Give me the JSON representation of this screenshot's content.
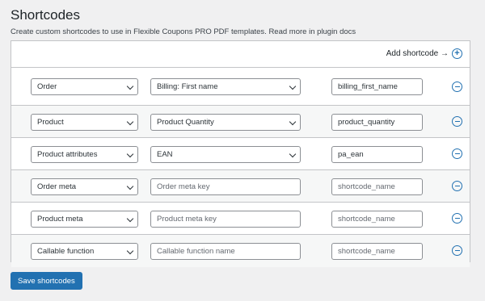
{
  "page": {
    "title": "Shortcodes",
    "description": "Create custom shortcodes to use in Flexible Coupons PRO PDF templates. Read more in plugin docs"
  },
  "panel": {
    "add_label": "Add shortcode →",
    "add_icon": "plus-circle-icon"
  },
  "rows": [
    {
      "type": "Order",
      "field": "Billing: First name",
      "field_kind": "select",
      "shortcode": "billing_first_name",
      "shortcode_is_placeholder": false
    },
    {
      "type": "Product",
      "field": "Product Quantity",
      "field_kind": "select",
      "shortcode": "product_quantity",
      "shortcode_is_placeholder": false
    },
    {
      "type": "Product attributes",
      "field": "EAN",
      "field_kind": "select",
      "shortcode": "pa_ean",
      "shortcode_is_placeholder": false
    },
    {
      "type": "Order meta",
      "field": "Order meta key",
      "field_kind": "input-placeholder",
      "shortcode": "shortcode_name",
      "shortcode_is_placeholder": true
    },
    {
      "type": "Product meta",
      "field": "Product meta key",
      "field_kind": "input-placeholder",
      "shortcode": "shortcode_name",
      "shortcode_is_placeholder": true
    },
    {
      "type": "Callable function",
      "field": "Callable function name",
      "field_kind": "input-placeholder",
      "shortcode": "shortcode_name",
      "shortcode_is_placeholder": true
    }
  ],
  "save_label": "Save shortcodes",
  "colors": {
    "accent": "#2271b1",
    "background": "#f0f0f1",
    "border": "#c3c4c7"
  }
}
